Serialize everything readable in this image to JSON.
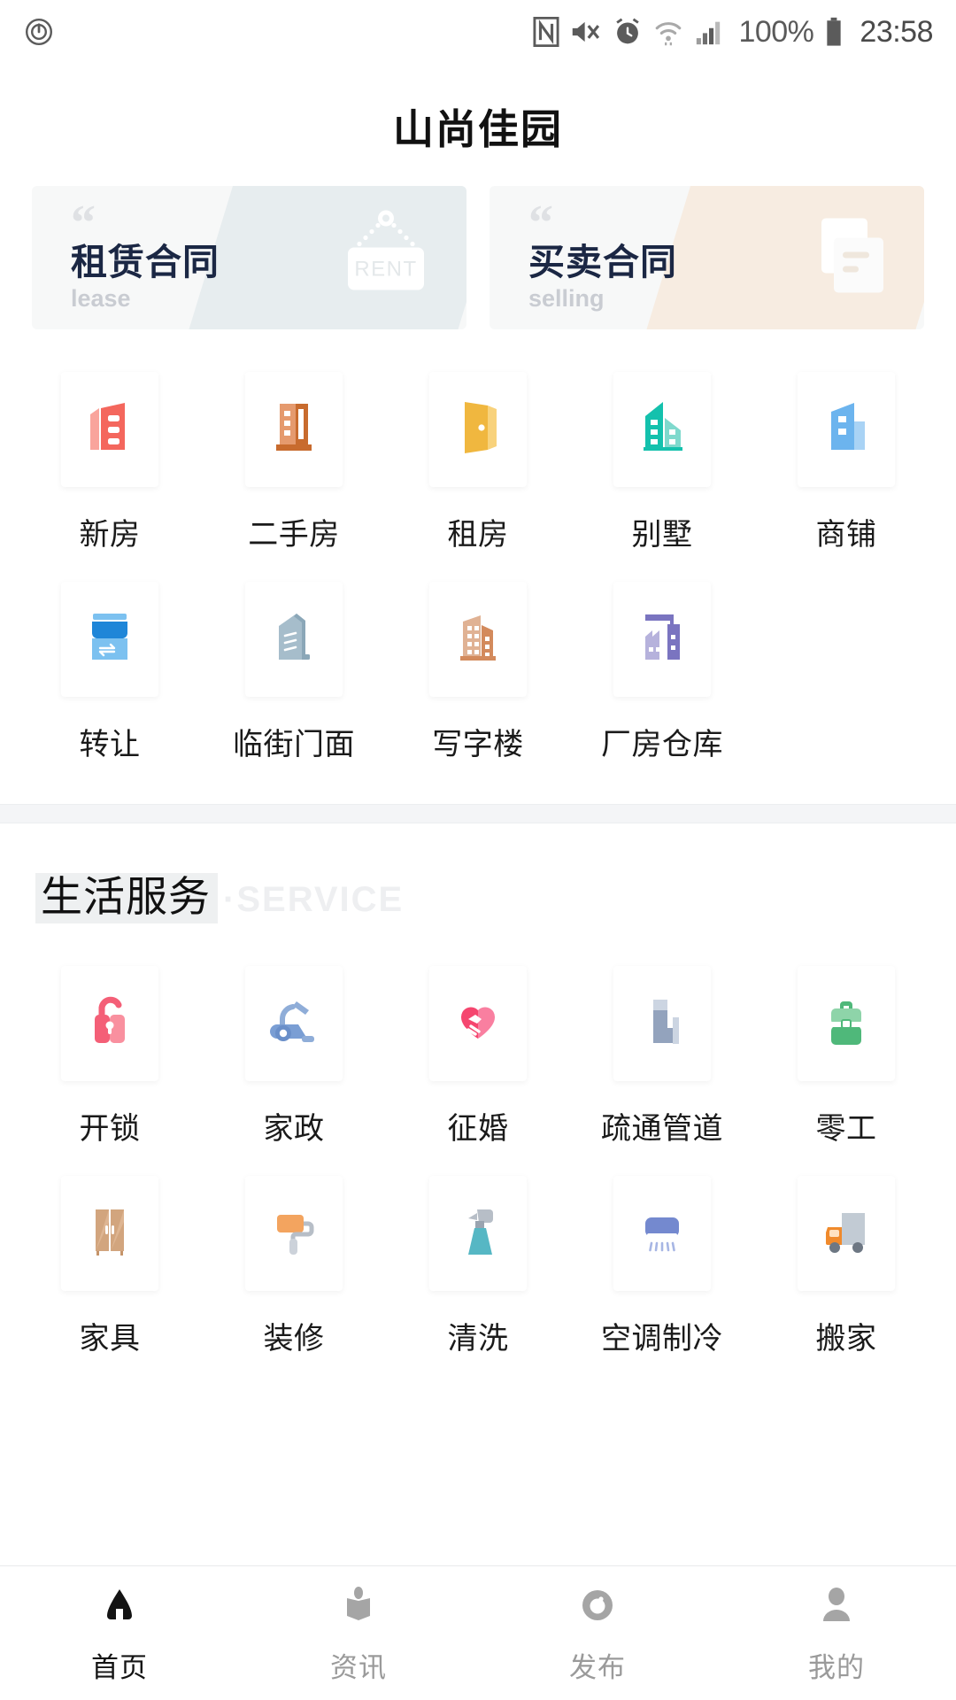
{
  "statusbar": {
    "left_icon": "power-recording-icon",
    "icons": [
      "nfc-icon",
      "mute-icon",
      "alarm-icon",
      "wifi-icon",
      "signal-icon"
    ],
    "battery_percent": "100%",
    "battery_icon": "battery-full-icon",
    "time": "23:58"
  },
  "header": {
    "title": "山尚佳园"
  },
  "contracts": [
    {
      "title": "租赁合同",
      "subtitle": "lease",
      "quote": "“",
      "art": "rent-sign-icon",
      "art_text": "RENT",
      "wedge_color": "#e7edef",
      "title_color": "#1b2744"
    },
    {
      "title": "买卖合同",
      "subtitle": "selling",
      "quote": "“",
      "art": "document-icon",
      "art_text": "",
      "wedge_color": "#f7ece1",
      "title_color": "#1b2744"
    }
  ],
  "property_grid": [
    {
      "label": "新房",
      "icon": "red-building-icon",
      "color": "#f4675d"
    },
    {
      "label": "二手房",
      "icon": "orange-tower-icon",
      "color": "#d9722f"
    },
    {
      "label": "租房",
      "icon": "yellow-door-icon",
      "color": "#f0b73f"
    },
    {
      "label": "别墅",
      "icon": "teal-villa-icon",
      "color": "#14c1ad"
    },
    {
      "label": "商铺",
      "icon": "blue-shop-building-icon",
      "color": "#6cb4ee"
    },
    {
      "label": "转让",
      "icon": "shop-awning-icon",
      "color": "#1f86d8"
    },
    {
      "label": "临街门面",
      "icon": "street-storefront-icon",
      "color": "#a6bdcb"
    },
    {
      "label": "写字楼",
      "icon": "office-towers-icon",
      "color": "#d8a181"
    },
    {
      "label": "厂房仓库",
      "icon": "factory-warehouse-icon",
      "color": "#7a74c0"
    }
  ],
  "service_section": {
    "title_cn": "生活服务",
    "separator": "·",
    "title_en": "SERVICE"
  },
  "service_grid": [
    {
      "label": "开锁",
      "icon": "open-lock-icon",
      "color": "#f45f77"
    },
    {
      "label": "家政",
      "icon": "vacuum-cleaner-icon",
      "color": "#7a9ed4"
    },
    {
      "label": "征婚",
      "icon": "heart-handshake-icon",
      "color": "#f5466f"
    },
    {
      "label": "疏通管道",
      "icon": "pipe-icon",
      "color": "#93a3bd"
    },
    {
      "label": "零工",
      "icon": "briefcase-icon",
      "color": "#4fb87a"
    },
    {
      "label": "家具",
      "icon": "wardrobe-icon",
      "color": "#d2a57e"
    },
    {
      "label": "装修",
      "icon": "paint-roller-icon",
      "color": "#f3a45f"
    },
    {
      "label": "清洗",
      "icon": "spray-bottle-icon",
      "color": "#56b7c4"
    },
    {
      "label": "空调制冷",
      "icon": "air-conditioner-icon",
      "color": "#7489cf"
    },
    {
      "label": "搬家",
      "icon": "moving-truck-icon",
      "color": "#f08a2c"
    }
  ],
  "bottom_nav": [
    {
      "label": "首页",
      "icon": "home-icon",
      "active": true
    },
    {
      "label": "资讯",
      "icon": "book-icon",
      "active": false
    },
    {
      "label": "发布",
      "icon": "publish-icon",
      "active": false
    },
    {
      "label": "我的",
      "icon": "person-icon",
      "active": false
    }
  ]
}
